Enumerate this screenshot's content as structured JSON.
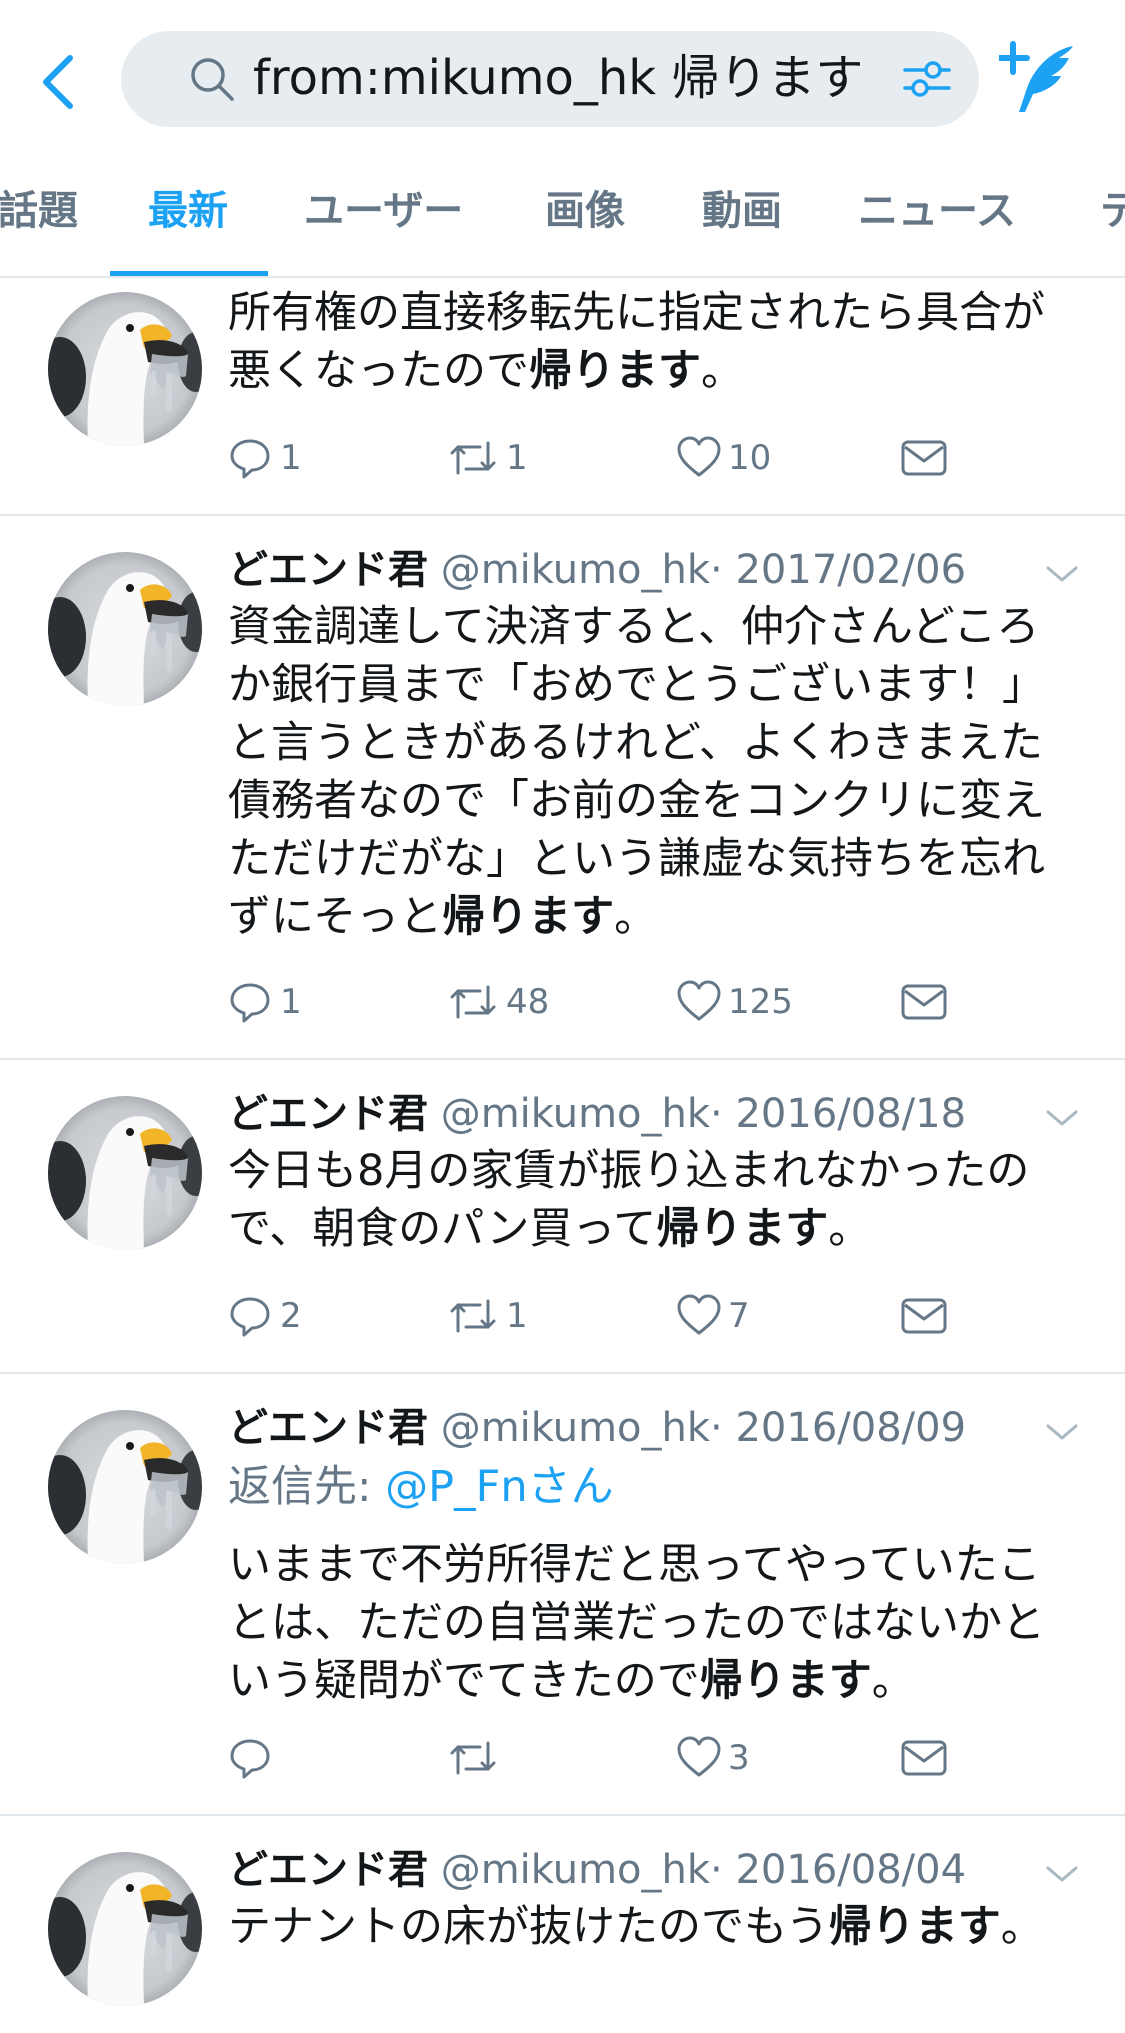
{
  "search": {
    "query": "from:mikumo_hk  帰ります"
  },
  "tabs": [
    {
      "label": "話題"
    },
    {
      "label": "最新"
    },
    {
      "label": "ユーザー"
    },
    {
      "label": "画像"
    },
    {
      "label": "動画"
    },
    {
      "label": "ニュース"
    },
    {
      "label": "テ"
    }
  ],
  "active_tab": "最新",
  "colors": {
    "accent": "#1da1f2",
    "secondary_text": "#657786",
    "divider": "#e1e8ed"
  },
  "tweets": [
    {
      "text_plain": "所有権の直接移転先に指定されたら具合が悪くなったので",
      "text_bold": "帰ります",
      "text_end": "。",
      "reply_count": "1",
      "retweet_count": "1",
      "like_count": "10"
    },
    {
      "name": "どエンド君",
      "handle": "@mikumo_hk",
      "date": "· 2017/02/06",
      "text_plain": "資金調達して決済すると、仲介さんどころか銀行員まで「おめでとうございます！」と言うときがあるけれど、よくわきまえた債務者なので「お前の金をコンクリに変えただけだがな」という謙虚な気持ちを忘れずにそっと",
      "text_bold": "帰ります",
      "text_end": "。",
      "reply_count": "1",
      "retweet_count": "48",
      "like_count": "125"
    },
    {
      "name": "どエンド君",
      "handle": "@mikumo_hk",
      "date": "· 2016/08/18",
      "text_plain": "今日も8月の家賃が振り込まれなかったので、朝食のパン買って",
      "text_bold": "帰ります",
      "text_end": "。",
      "reply_count": "2",
      "retweet_count": "1",
      "like_count": "7"
    },
    {
      "name": "どエンド君",
      "handle": "@mikumo_hk",
      "date": "· 2016/08/09",
      "reply_label": "返信先: ",
      "reply_mention": "@P_Fnさん",
      "text_plain": "いままで不労所得だと思ってやっていたことは、ただの自営業だったのではないかという疑問がでてきたので",
      "text_bold": "帰ります",
      "text_end": "。",
      "like_count": "3"
    },
    {
      "name": "どエンド君",
      "handle": "@mikumo_hk",
      "date": "· 2016/08/04",
      "text_plain": "テナントの床が抜けたのでもう",
      "text_bold": "帰ります",
      "text_end": "。"
    }
  ]
}
